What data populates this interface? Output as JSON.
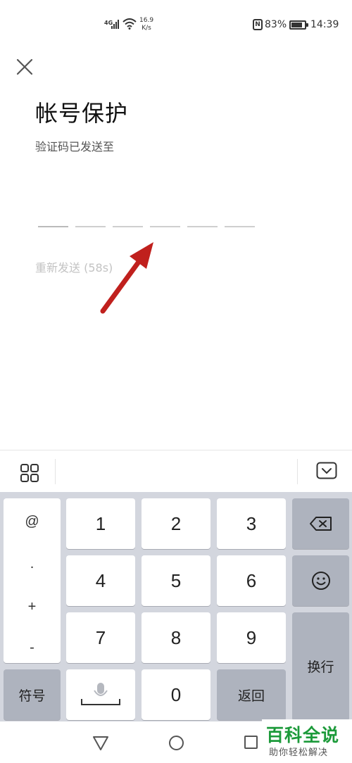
{
  "status_bar": {
    "network_type": "4G",
    "speed_value": "16.9",
    "speed_unit": "K/s",
    "nfc_label": "N",
    "battery_percent": "83%",
    "battery_level": 0.83,
    "time": "14:39"
  },
  "page": {
    "title": "帐号保护",
    "subtitle": "验证码已发送至",
    "code_length": 6,
    "resend_label": "重新发送 (58s)"
  },
  "keyboard": {
    "symbols": [
      "@",
      ".",
      "+",
      "-"
    ],
    "digits": [
      "1",
      "2",
      "3",
      "4",
      "5",
      "6",
      "7",
      "8",
      "9",
      "0"
    ],
    "symbol_key_label": "符号",
    "return_key_label": "返回",
    "newline_key_label": "换行",
    "mic_icon": "microphone-icon",
    "delete_icon": "backspace-icon",
    "emoji_icon": "emoji-icon",
    "menu_icon": "grid-menu-icon",
    "hide_icon": "keyboard-hide-icon"
  },
  "watermark": {
    "title": "百科全说",
    "subtitle": "助你轻松解决"
  },
  "colors": {
    "arrow": "#c0201d",
    "watermark_green": "#1c9a3a",
    "keyboard_bg": "#d3d6de",
    "function_key": "#aeb3be"
  }
}
